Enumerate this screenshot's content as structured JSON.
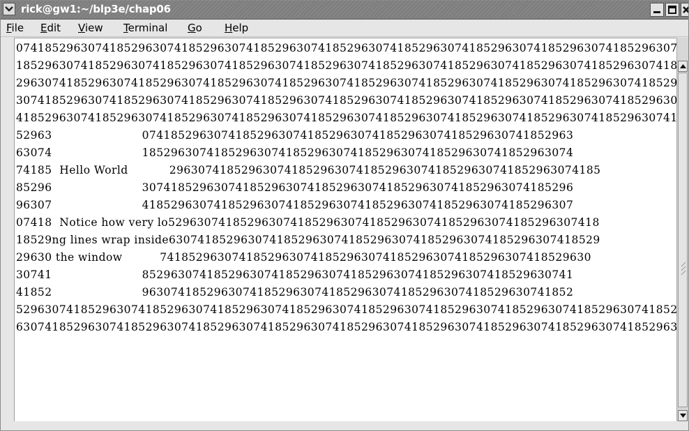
{
  "window": {
    "title": "rick@gw1:~/blp3e/chap06"
  },
  "menu": [
    {
      "label_prefix": "",
      "accel": "F",
      "label_rest": "ile"
    },
    {
      "label_prefix": "",
      "accel": "E",
      "label_rest": "dit"
    },
    {
      "label_prefix": "",
      "accel": "V",
      "label_rest": "iew"
    },
    {
      "label_prefix": "",
      "accel": "T",
      "label_rest": "erminal"
    },
    {
      "label_prefix": "",
      "accel": "G",
      "label_rest": "o"
    },
    {
      "label_prefix": "",
      "accel": "H",
      "label_rest": "elp"
    }
  ],
  "terminal": {
    "lines": [
      "07418529630741852963074185296307418529630741852963074185296307418529630741852963074185296307418",
      "18529630741852963074185296307418529630741852963074185296307418529630741852963074185296307418529",
      "29630741852963074185296307418529630741852963074185296307418529630741852963074185296307418529630",
      "30741852963074185296307418529630741852963074185296307418529630741852963074185296307418529630741",
      "41852963074185296307418529630741852963074185296307418529630741852963074185296307418529630741852",
      "52963                        074185296307418529630741852963074185296307418529630741852963",
      "63074                        185296307418529630741852963074185296307418529630741852963074",
      "74185  Hello World           296307418529630741852963074185296307418529630741852963074185",
      "85296                        307418529630741852963074185296307418529630741852963074185296",
      "96307                        418529630741852963074185296307418529630741852963074185296307",
      "07418  Notice how very lo529630741852963074185296307418529630741852963074185296307418",
      "18529ng lines wrap inside630741852963074185296307418529630741852963074185296307418529",
      "29630 the window          741852963074185296307418529630741852963074185296307418529630",
      "30741                        852963074185296307418529630741852963074185296307418529630741",
      "41852                        963074185296307418529630741852963074185296307418529630741852",
      "52963074185296307418529630741852963074185296307418529630741852963074185296307418529630741852963",
      "63074185296307418529630741852963074185296307418529630741852963074185296307418529630741852963074"
    ]
  },
  "colors": {
    "titlebar": "#7e7e7e",
    "menubar": "#e6e6e6",
    "terminal_bg": "#ffffff",
    "text": "#000000"
  },
  "icons": {
    "window_menu": "chevron-down-icon",
    "minimize": "minimize-icon",
    "maximize": "maximize-icon",
    "close": "close-icon",
    "scroll_up": "arrow-up-icon",
    "scroll_down": "arrow-down-icon"
  }
}
